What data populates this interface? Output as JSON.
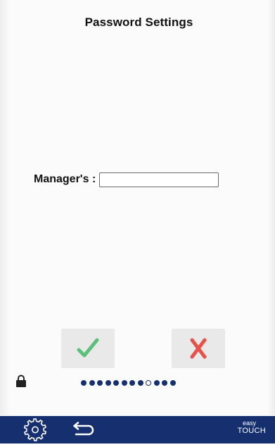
{
  "header": {
    "title": "Password Settings"
  },
  "form": {
    "manager_label": "Manager's :",
    "manager_value": "",
    "manager_placeholder": ""
  },
  "actions": {
    "confirm_icon": "checkmark-icon",
    "cancel_icon": "cross-icon",
    "confirm_color": "#5cc07a",
    "cancel_color": "#e8504a"
  },
  "pagination": {
    "total": 12,
    "current": 9
  },
  "status": {
    "lock_icon": "lock-icon"
  },
  "bottom_bar": {
    "settings_icon": "gear-icon",
    "back_icon": "back-arrow-icon",
    "brand_line1": "easy",
    "brand_line2": "TOUCH",
    "bar_color": "#16306f"
  }
}
